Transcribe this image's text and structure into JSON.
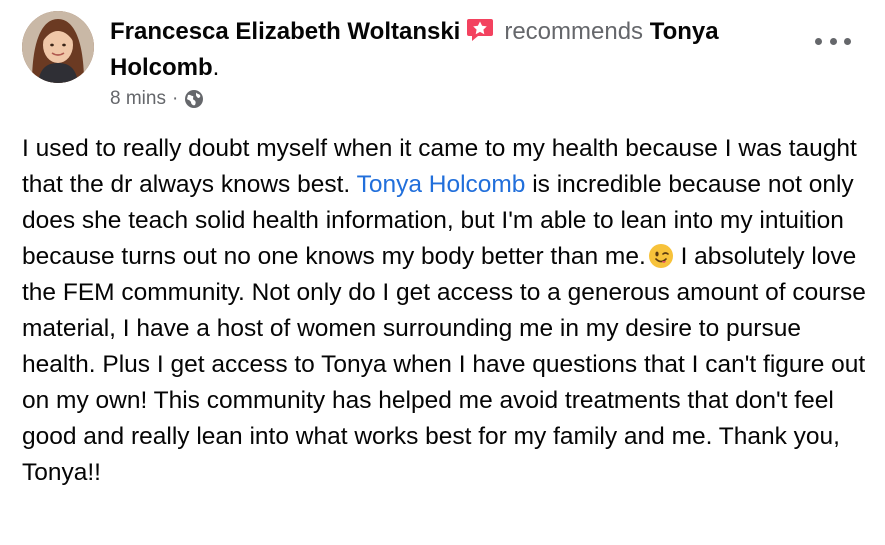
{
  "post": {
    "author_name": "Francesca Elizabeth Woltanski",
    "verb": "recommends",
    "page_name": "Tonya Holcomb",
    "period": ".",
    "timestamp": "8 mins",
    "separator": "·",
    "avatar_icon": "profile-photo",
    "badge_icon": "recommendation-star-icon",
    "privacy_icon": "globe-icon",
    "more_icon": "more-options-icon",
    "body_part1": "I used to really doubt myself when it came to my health because I was taught that the dr always knows best.  ",
    "mention": "Tonya Holcomb",
    "body_part2": " is incredible because not only does she teach solid health information, but I'm able to lean into my intuition because turns out no one knows my body better than me.",
    "emoji_icon": "winking-face-emoji",
    "body_part3": "  I absolutely love the FEM community.  Not only do I get access to a generous amount of course material, I have a host of women surrounding me in my desire to pursue health.  Plus I get access to Tonya when I have questions that I can't figure out on my own!  This community has helped me avoid treatments that don't feel good and really lean into what works best for my family and me.  Thank you, Tonya!!"
  },
  "colors": {
    "mention": "#216fdb",
    "badge": "#f3425f",
    "secondary_text": "#65676b"
  }
}
